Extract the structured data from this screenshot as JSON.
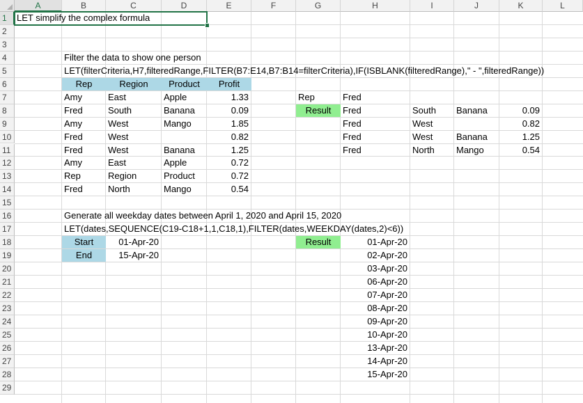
{
  "columns": [
    "A",
    "B",
    "C",
    "D",
    "E",
    "F",
    "G",
    "H",
    "I",
    "J",
    "K",
    "L"
  ],
  "rows": [
    "1",
    "2",
    "3",
    "4",
    "5",
    "6",
    "7",
    "8",
    "9",
    "10",
    "11",
    "12",
    "13",
    "14",
    "15",
    "16",
    "17",
    "18",
    "19",
    "20",
    "21",
    "22",
    "23",
    "24",
    "25",
    "26",
    "27",
    "28",
    "29"
  ],
  "title": "LET simplify the complex formula",
  "section1": {
    "heading": "Filter the data to show one person",
    "formula": "LET(filterCriteria,H7,filteredRange,FILTER(B7:E14,B7:B14=filterCriteria),IF(ISBLANK(filteredRange),\" - \",filteredRange))",
    "table_headers": [
      "Rep",
      "Region",
      "Product",
      "Profit"
    ],
    "table_rows": [
      [
        "Amy",
        "East",
        "Apple",
        "1.33"
      ],
      [
        "Fred",
        "South",
        "Banana",
        "0.09"
      ],
      [
        "Amy",
        "West",
        "Mango",
        "1.85"
      ],
      [
        "Fred",
        "West",
        "",
        "0.82"
      ],
      [
        "Fred",
        "West",
        "Banana",
        "1.25"
      ],
      [
        "Amy",
        "East",
        "Apple",
        "0.72"
      ],
      [
        "Rep",
        "Region",
        "Product",
        "0.72"
      ],
      [
        "Fred",
        "North",
        "Mango",
        "0.54"
      ]
    ],
    "rep_label": "Rep",
    "rep_value": "Fred",
    "result_label": "Result",
    "result_rows": [
      [
        "Fred",
        "South",
        "Banana",
        "0.09"
      ],
      [
        "Fred",
        "West",
        "",
        "0.82"
      ],
      [
        "Fred",
        "West",
        "Banana",
        "1.25"
      ],
      [
        "Fred",
        "North",
        "Mango",
        "0.54"
      ]
    ]
  },
  "section2": {
    "heading": "Generate all weekday dates between April 1, 2020 and April 15, 2020",
    "formula": "LET(dates,SEQUENCE(C19-C18+1,1,C18,1),FILTER(dates,WEEKDAY(dates,2)<6))",
    "start_label": "Start",
    "start_value": "01-Apr-20",
    "end_label": "End",
    "end_value": "15-Apr-20",
    "result_label": "Result",
    "dates": [
      "01-Apr-20",
      "02-Apr-20",
      "03-Apr-20",
      "06-Apr-20",
      "07-Apr-20",
      "08-Apr-20",
      "09-Apr-20",
      "10-Apr-20",
      "13-Apr-20",
      "14-Apr-20",
      "15-Apr-20"
    ]
  },
  "colors": {
    "header_fill": "#add8e6",
    "result_fill": "#90ee90",
    "selection": "#217346"
  }
}
